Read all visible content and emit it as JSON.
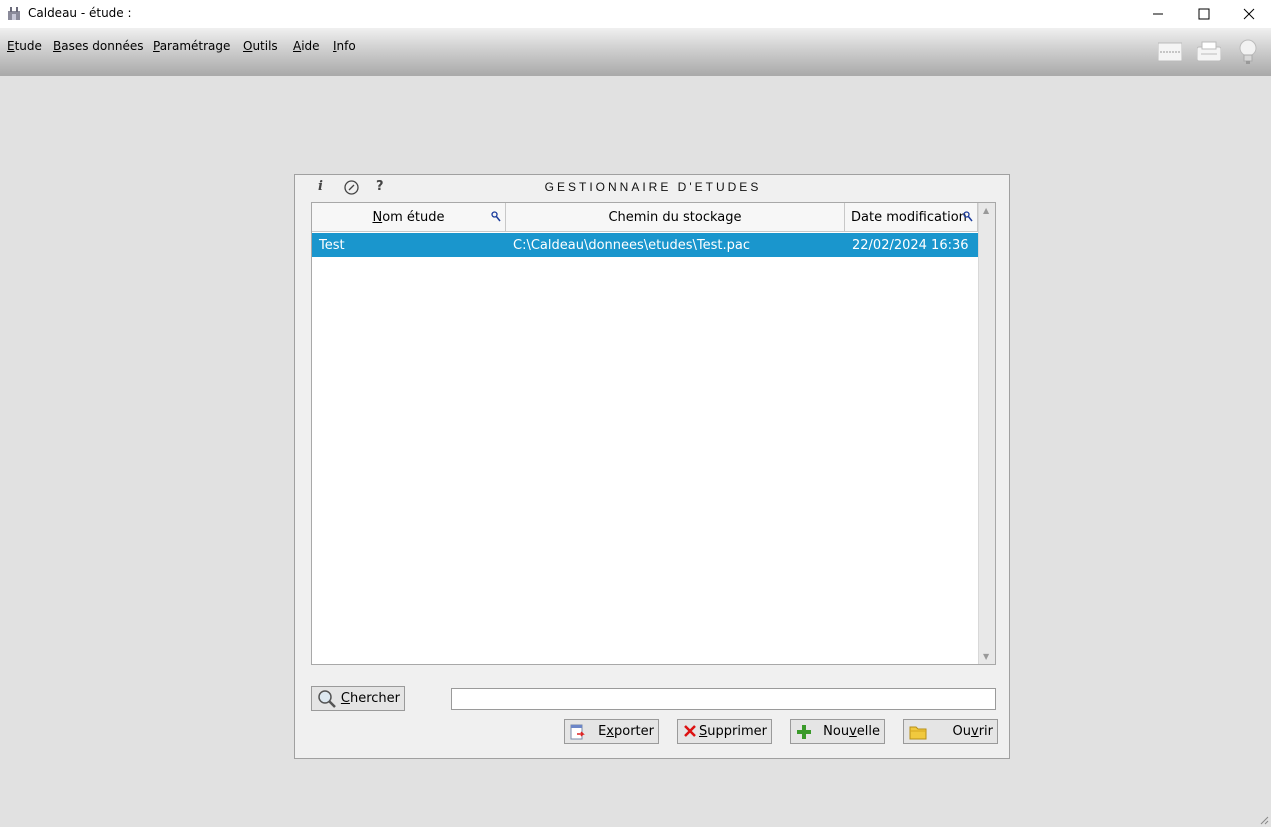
{
  "window": {
    "title": "Caldeau - étude :"
  },
  "menu": [
    {
      "accel": "E",
      "rest": "tude"
    },
    {
      "accel": "B",
      "rest": "ases données"
    },
    {
      "accel": "P",
      "rest": "aramétrage"
    },
    {
      "accel": "O",
      "rest": "utils"
    },
    {
      "accel": "A",
      "rest": "ide"
    },
    {
      "accel": "I",
      "rest": "nfo"
    }
  ],
  "toolbar_icons": [
    "ruler-icon",
    "printer-icon",
    "lightbulb-icon"
  ],
  "dialog": {
    "title": "GESTIONNAIRE D'ETUDES",
    "tools": [
      "i",
      "?"
    ],
    "columns": [
      {
        "accel": "N",
        "rest": "om étude"
      },
      {
        "label": "Chemin du stockage"
      },
      {
        "label": "Date modification"
      }
    ],
    "rows": [
      {
        "name": "Test",
        "path": "C:\\Caldeau\\donnees\\etudes\\Test.pac",
        "date": "22/02/2024 16:36",
        "selected": true
      }
    ],
    "search_button": {
      "accel": "C",
      "rest": "hercher"
    },
    "search_value": "",
    "buttons": {
      "export": {
        "pre": "E",
        "accel": "x",
        "rest": "porter"
      },
      "delete": {
        "accel": "S",
        "rest": "upprimer"
      },
      "new": {
        "pre": "Nou",
        "accel": "v",
        "rest": "elle"
      },
      "open": {
        "pre": "Ou",
        "accel": "v",
        "rest": "rir"
      }
    }
  },
  "colors": {
    "selection": "#1a96cd",
    "background": "#e1e1e1"
  }
}
